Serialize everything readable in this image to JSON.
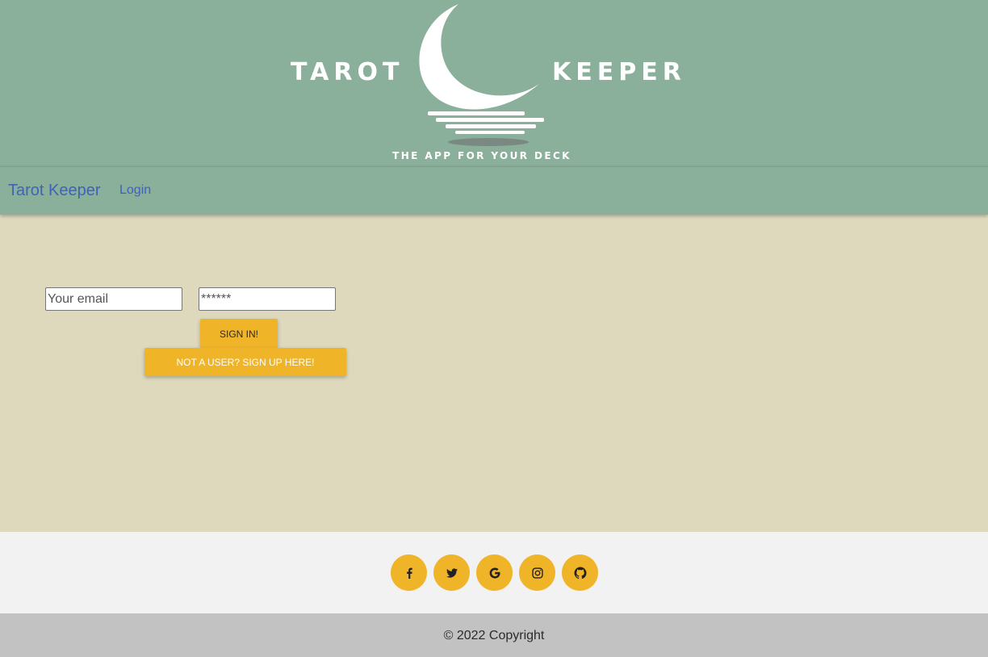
{
  "banner": {
    "logo_word_left": "TAROT",
    "logo_word_right": "KEEPER",
    "tagline": "THE APP FOR YOUR DECK"
  },
  "navbar": {
    "brand": "Tarot Keeper",
    "login_link": "Login"
  },
  "login_form": {
    "email_placeholder": "Your email",
    "password_placeholder": "******",
    "signin_label": "Sign In!",
    "signup_label": "Not a user? Sign up here!"
  },
  "footer": {
    "social_icons": [
      "facebook-icon",
      "twitter-icon",
      "google-icon",
      "instagram-icon",
      "github-icon"
    ],
    "copyright": "© 2022 Copyright"
  },
  "colors": {
    "header_green": "#8aaf9a",
    "main_beige": "#ded9bd",
    "accent_gold": "#f0b429",
    "link_blue": "#3f63b5",
    "footer_light": "#f2f2f2",
    "copyright_gray": "#c2c2c2"
  }
}
